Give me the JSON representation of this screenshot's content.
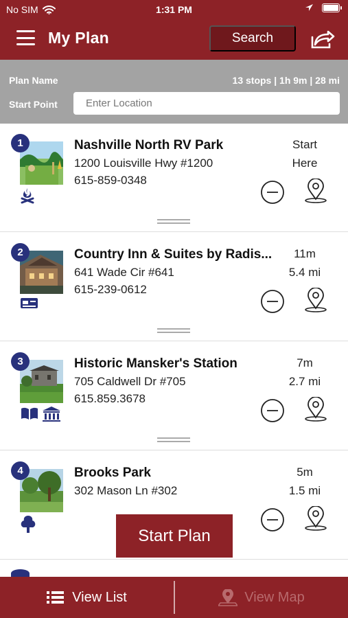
{
  "status": {
    "carrier": "No SIM",
    "time": "1:31 PM"
  },
  "header": {
    "title": "My Plan",
    "search_label": "Search"
  },
  "plan": {
    "name_label": "Plan Name",
    "summary": "13 stops | 1h 9m | 28 mi",
    "start_label": "Start Point",
    "location_placeholder": "Enter Location"
  },
  "stops": [
    {
      "number": "1",
      "name": "Nashville North RV Park",
      "address": "1200 Louisville Hwy #1200",
      "phone": "615-859-0348",
      "metric1": "Start",
      "metric2": "Here",
      "icons": [
        "campfire-icon"
      ]
    },
    {
      "number": "2",
      "name": "Country Inn & Suites by Radis...",
      "address": "641 Wade Cir #641",
      "phone": "615-239-0612",
      "metric1": "11m",
      "metric2": "5.4 mi",
      "icons": [
        "hotel-card-icon"
      ]
    },
    {
      "number": "3",
      "name": "Historic Mansker's Station",
      "address": "705 Caldwell Dr #705",
      "phone": "615.859.3678",
      "metric1": "7m",
      "metric2": "2.7 mi",
      "icons": [
        "book-icon",
        "museum-icon"
      ]
    },
    {
      "number": "4",
      "name": "Brooks Park",
      "address": "302 Mason Ln #302",
      "phone": "",
      "metric1": "5m",
      "metric2": "1.5 mi",
      "icons": [
        "tree-icon"
      ]
    }
  ],
  "actions": {
    "start_plan": "Start Plan",
    "view_list": "View List",
    "view_map": "View Map"
  },
  "colors": {
    "brand": "#8d2227",
    "dark_brand": "#6f181c",
    "stop_number": "#28317c",
    "gray_bar": "#a3a3a3"
  }
}
